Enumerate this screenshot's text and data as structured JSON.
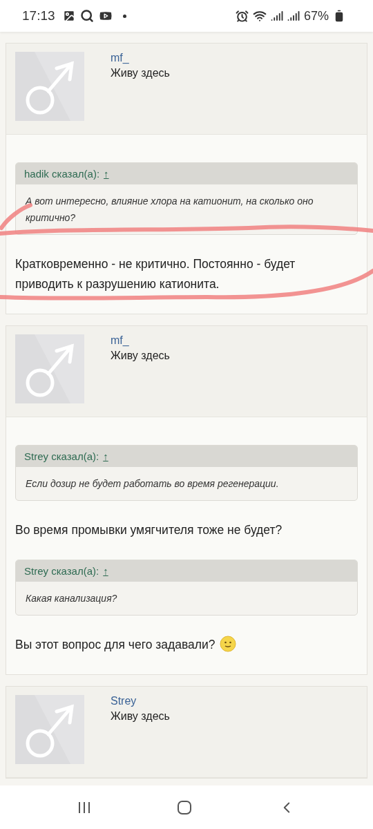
{
  "status_bar": {
    "time": "17:13",
    "battery": "67%"
  },
  "posts": [
    {
      "author": "mf_",
      "user_title": "Живу здесь",
      "blocks": [
        {
          "kind": "quote",
          "author": "hadik сказал(а):",
          "link": "↑",
          "text": "А вот интересно, влияние хлора на катионит, на сколько оно критично?"
        },
        {
          "kind": "text",
          "text": "Кратковременно - не критично. Постоянно - будет приводить к разрушению катионита."
        }
      ]
    },
    {
      "author": "mf_",
      "user_title": "Живу здесь",
      "blocks": [
        {
          "kind": "quote",
          "author": "Strey сказал(а):",
          "link": "↑",
          "text": "Если дозир не будет работать во время регенерации."
        },
        {
          "kind": "text",
          "text": "Во время промывки умягчителя тоже не будет?"
        },
        {
          "kind": "quote",
          "author": "Strey сказал(а):",
          "link": "↑",
          "text": "Какая канализация?"
        },
        {
          "kind": "text_smiley",
          "text": "Вы этот вопрос для чего задавали?"
        }
      ]
    },
    {
      "author": "Strey",
      "user_title": "Живу здесь"
    }
  ],
  "annotation": {
    "kind": "freehand_loop"
  }
}
